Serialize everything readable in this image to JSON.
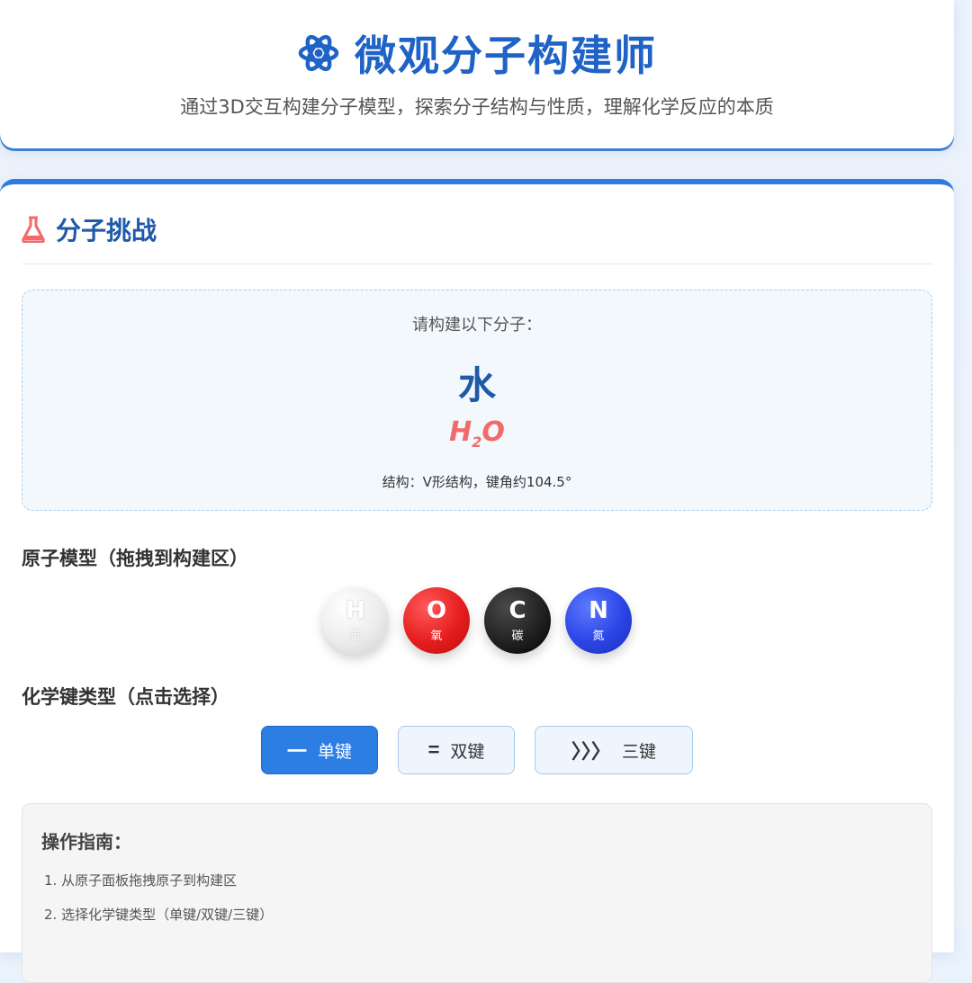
{
  "header": {
    "title": "微观分子构建师",
    "subtitle": "通过3D交互构建分子模型，探索分子结构与性质，理解化学反应的本质",
    "icon": "atom-icon"
  },
  "challenge": {
    "section_title": "分子挑战",
    "section_icon": "flask-icon",
    "prompt": "请构建以下分子：",
    "molecule_name": "水",
    "formula_main": "H",
    "formula_sub": "2",
    "formula_tail": "O",
    "structure": "结构：V形结构，键角约104.5°"
  },
  "atoms": {
    "heading": "原子模型（拖拽到构建区）",
    "items": [
      {
        "symbol": "H",
        "label": "氢",
        "color": "#e8e8e8"
      },
      {
        "symbol": "O",
        "label": "氧",
        "color": "#e51d1d"
      },
      {
        "symbol": "C",
        "label": "碳",
        "color": "#1e1e1e"
      },
      {
        "symbol": "N",
        "label": "氮",
        "color": "#2b45e6"
      }
    ]
  },
  "bonds": {
    "heading": "化学键类型（点击选择）",
    "items": [
      {
        "glyph": "一",
        "label": "单键",
        "active": true
      },
      {
        "glyph": "=",
        "label": "双键",
        "active": false
      },
      {
        "glyph": "〉〉〉",
        "label": "三键",
        "active": false
      }
    ]
  },
  "guide": {
    "title": "操作指南：",
    "steps": [
      "1. 从原子面板拖拽原子到构建区",
      "2. 选择化学键类型（单键/双键/三键）"
    ]
  },
  "colors": {
    "accent": "#2d7ee3",
    "title_blue": "#1e63c5",
    "formula_red": "#f26a6a"
  }
}
